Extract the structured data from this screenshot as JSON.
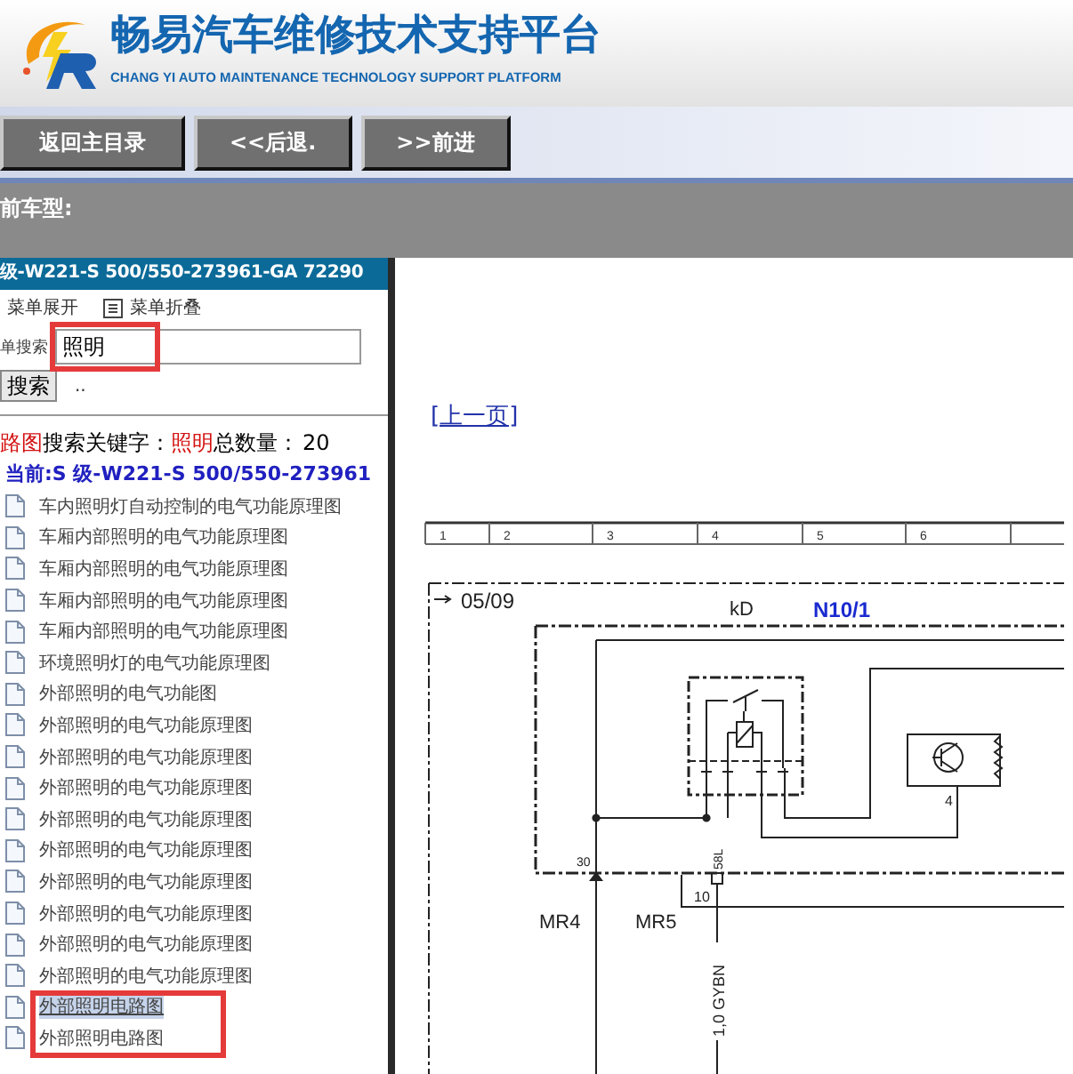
{
  "header": {
    "title": "畅易汽车维修技术支持平台",
    "subtitle": "CHANG YI AUTO MAINTENANCE TECHNOLOGY SUPPORT PLATFORM"
  },
  "nav_buttons": [
    "返回主目录",
    "<<后退.",
    ">>前进"
  ],
  "vehicle_bar": {
    "label": "前车型:"
  },
  "sidebar": {
    "title": "级-W221-S 500/550-273961-GA 72290",
    "menu_toggles": [
      "菜单展开",
      "菜单折叠"
    ],
    "search": {
      "label": "单搜索",
      "value": "照明",
      "button": "搜索",
      "hint": ".."
    },
    "result": {
      "prefix": "路图",
      "keyword_label": "搜索关键字：",
      "keyword": "照明",
      "count_label": "总数量：",
      "count": "20"
    },
    "current": "当前:S 级-W221-S 500/550-273961",
    "items": [
      {
        "label": "车内照明灯自动控制的电气功能原理图",
        "selected": false
      },
      {
        "label": "车厢内部照明的电气功能原理图",
        "selected": false
      },
      {
        "label": "车厢内部照明的电气功能原理图",
        "selected": false
      },
      {
        "label": "车厢内部照明的电气功能原理图",
        "selected": false
      },
      {
        "label": "车厢内部照明的电气功能原理图",
        "selected": false
      },
      {
        "label": "环境照明灯的电气功能原理图",
        "selected": false
      },
      {
        "label": "外部照明的电气功能图",
        "selected": false
      },
      {
        "label": "外部照明的电气功能原理图",
        "selected": false
      },
      {
        "label": "外部照明的电气功能原理图",
        "selected": false
      },
      {
        "label": "外部照明的电气功能原理图",
        "selected": false
      },
      {
        "label": "外部照明的电气功能原理图",
        "selected": false
      },
      {
        "label": "外部照明的电气功能原理图",
        "selected": false
      },
      {
        "label": "外部照明的电气功能原理图",
        "selected": false
      },
      {
        "label": "外部照明的电气功能原理图",
        "selected": false
      },
      {
        "label": "外部照明的电气功能原理图",
        "selected": false
      },
      {
        "label": "外部照明的电气功能原理图",
        "selected": false
      },
      {
        "label": "外部照明电路图",
        "selected": true
      },
      {
        "label": "外部照明电路图",
        "selected": false
      }
    ]
  },
  "content": {
    "prev_link": "[上一页]",
    "diagram": {
      "ruler": [
        "1",
        "2",
        "3",
        "4",
        "5",
        "6"
      ],
      "sheet_ref": "05/09",
      "module_code": "kD",
      "module_id": "N10/1",
      "pins": [
        "30",
        "58L",
        "10",
        "4"
      ],
      "connectors": [
        "MR4",
        "MR5"
      ],
      "wire_label": "1,0 GYBN"
    }
  }
}
